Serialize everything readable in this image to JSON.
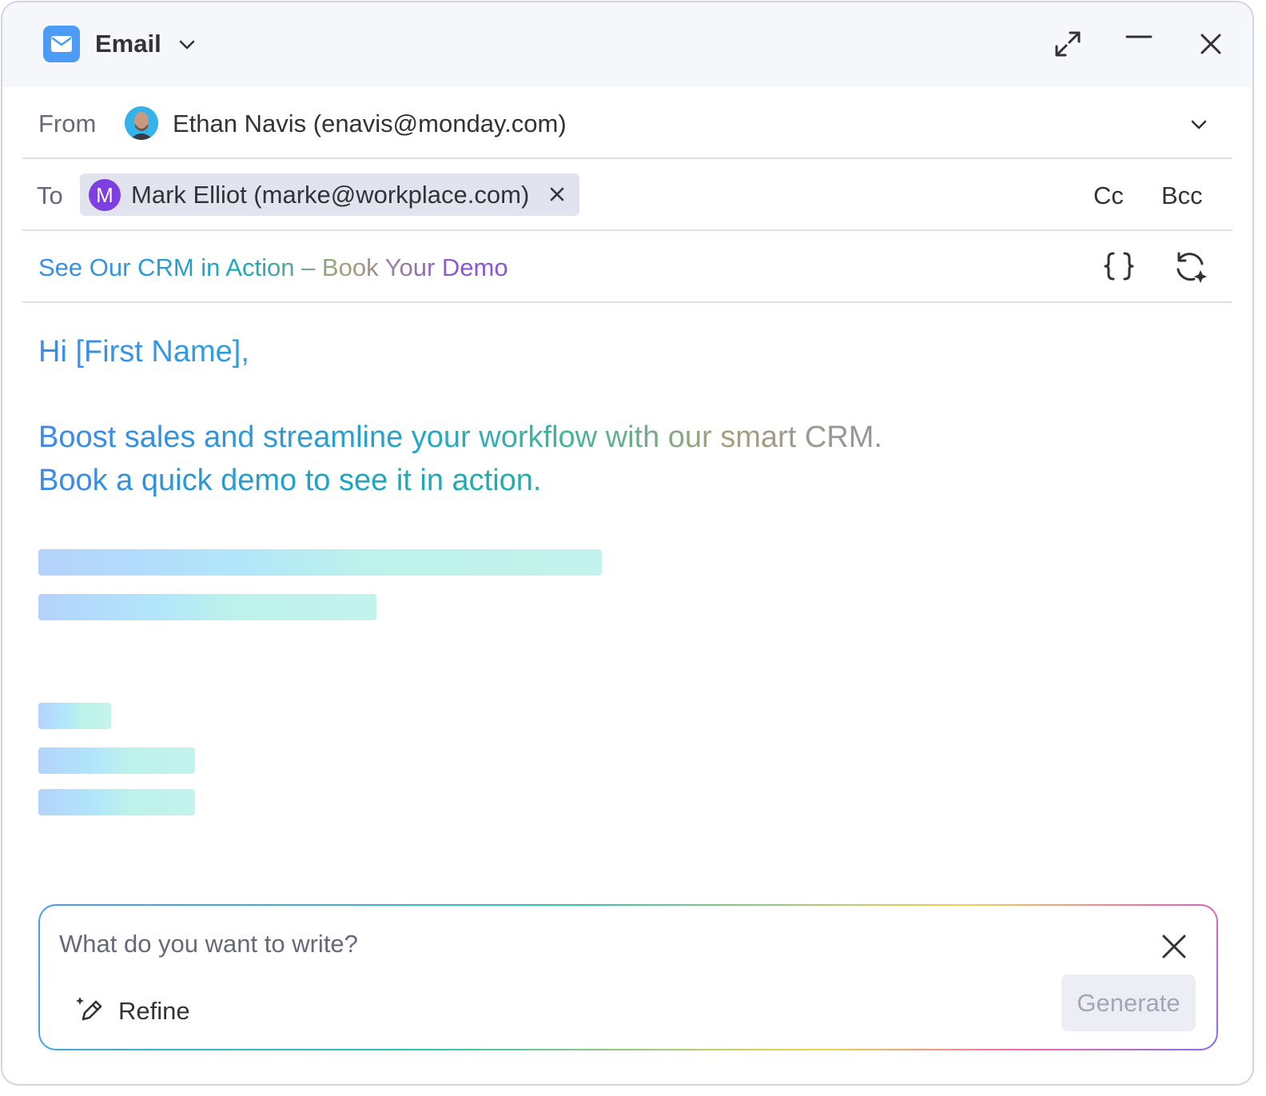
{
  "window": {
    "app_title": "Email",
    "icons": {
      "app": "mail-icon",
      "dropdown": "chevron-down-icon",
      "expand": "expand-icon",
      "minimize": "minimize-icon",
      "close": "close-icon"
    }
  },
  "from": {
    "label": "From",
    "value": "Ethan Navis (enavis@monday.com)"
  },
  "to": {
    "label": "To",
    "recipient_initial": "M",
    "recipient": "Mark Elliot (marke@workplace.com)",
    "cc_label": "Cc",
    "bcc_label": "Bcc"
  },
  "subject": {
    "text": "See Our CRM in Action – Book Your Demo",
    "icons": {
      "variables": "braces-icon",
      "regenerate": "ai-regenerate-icon"
    }
  },
  "body": {
    "greeting": "Hi [First Name],",
    "line1": "Boost sales and streamline your workflow with our smart CRM.",
    "line2": "Book a quick demo to see it in action."
  },
  "prompt": {
    "placeholder": "What do you want to write?",
    "refine_label": "Refine",
    "generate_label": "Generate"
  },
  "colors": {
    "accent": "#4c9bf5",
    "recipient_avatar": "#7e3ee0",
    "chip_bg": "#e1e4ef",
    "generate_disabled_bg": "#ecedf5"
  }
}
